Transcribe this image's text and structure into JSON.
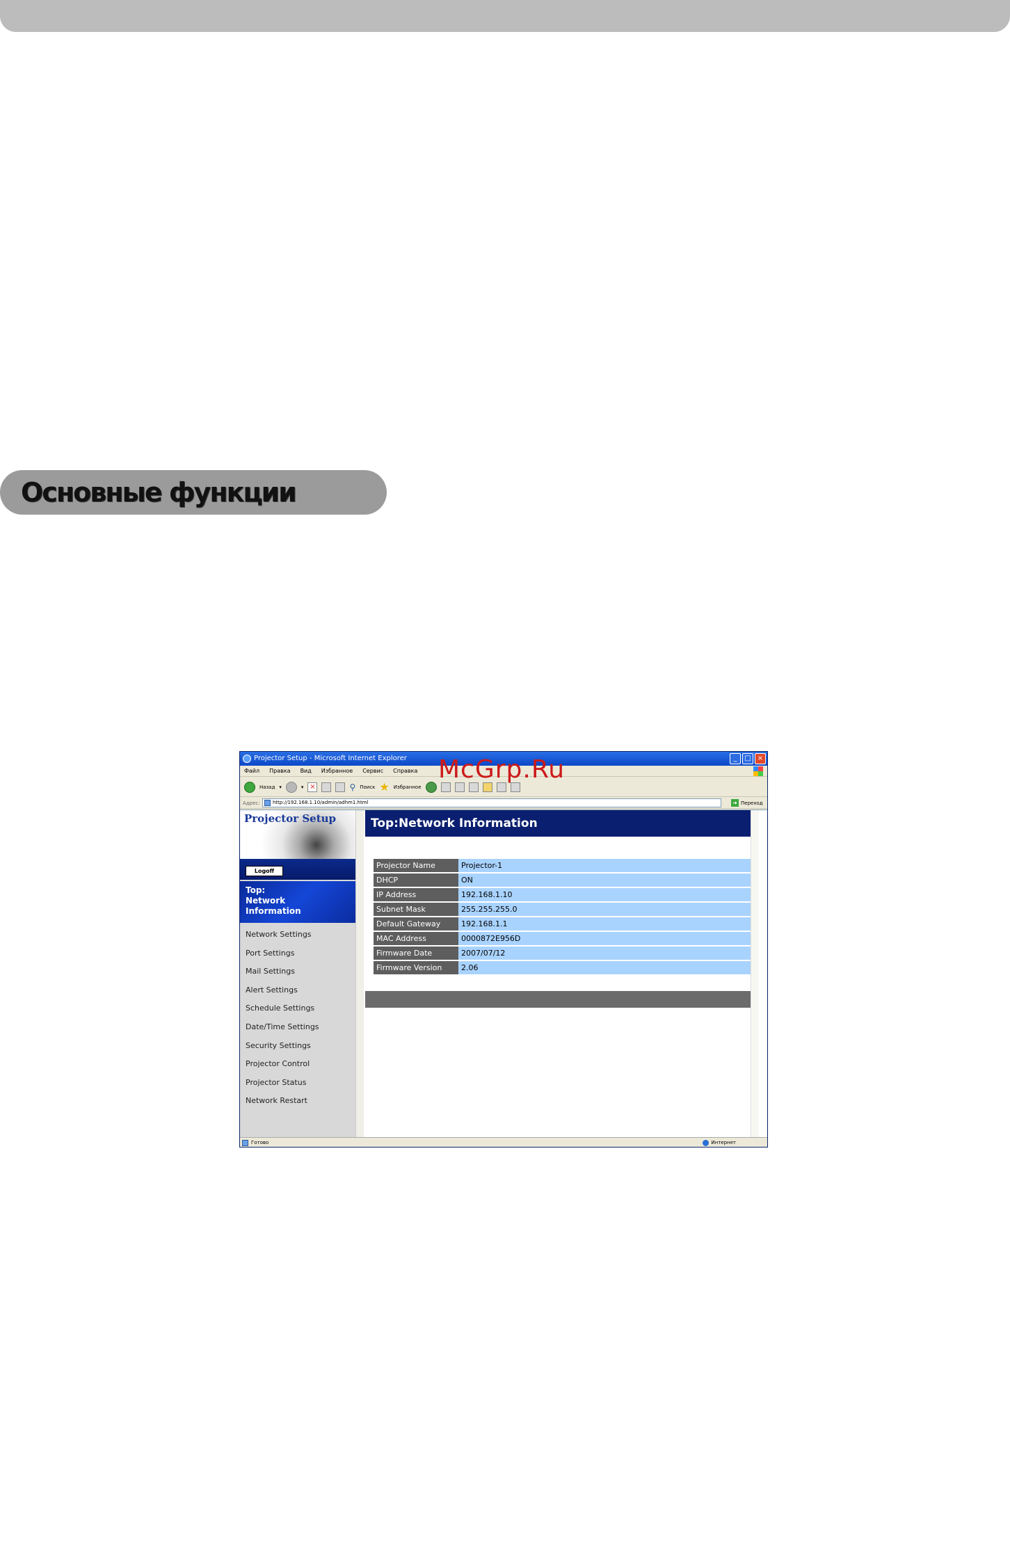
{
  "document": {
    "section_heading": "Основные функции"
  },
  "browser": {
    "title": "Projector Setup - Microsoft Internet Explorer",
    "menu": [
      "Файл",
      "Правка",
      "Вид",
      "Избранное",
      "Сервис",
      "Справка"
    ],
    "toolbar": {
      "back_label": "Назад",
      "search_label": "Поиск",
      "favorites_label": "Избранное"
    },
    "address": {
      "label": "Адрес:",
      "url": "http://192.168.1.10/admin/adhm1.html",
      "go_label": "Переход"
    },
    "status": {
      "text": "Готово",
      "zone": "Интернет"
    }
  },
  "page": {
    "logo": "Projector Setup",
    "logoff_label": "Logoff",
    "active_nav": [
      "Top:",
      "Network",
      "Information"
    ],
    "nav_items": [
      "Network Settings",
      "Port Settings",
      "Mail Settings",
      "Alert Settings",
      "Schedule Settings",
      "Date/Time Settings",
      "Security Settings",
      "Projector Control",
      "Projector Status",
      "Network Restart"
    ],
    "header": "Top:Network Information",
    "info": [
      {
        "label": "Projector Name",
        "value": "Projector-1"
      },
      {
        "label": "DHCP",
        "value": "ON"
      },
      {
        "label": "IP Address",
        "value": "192.168.1.10"
      },
      {
        "label": "Subnet Mask",
        "value": "255.255.255.0"
      },
      {
        "label": "Default Gateway",
        "value": "192.168.1.1"
      },
      {
        "label": "MAC Address",
        "value": "0000872E956D"
      },
      {
        "label": "Firmware Date",
        "value": "2007/07/12"
      },
      {
        "label": "Firmware Version",
        "value": "2.06"
      }
    ]
  },
  "watermark": "McGrp.Ru"
}
